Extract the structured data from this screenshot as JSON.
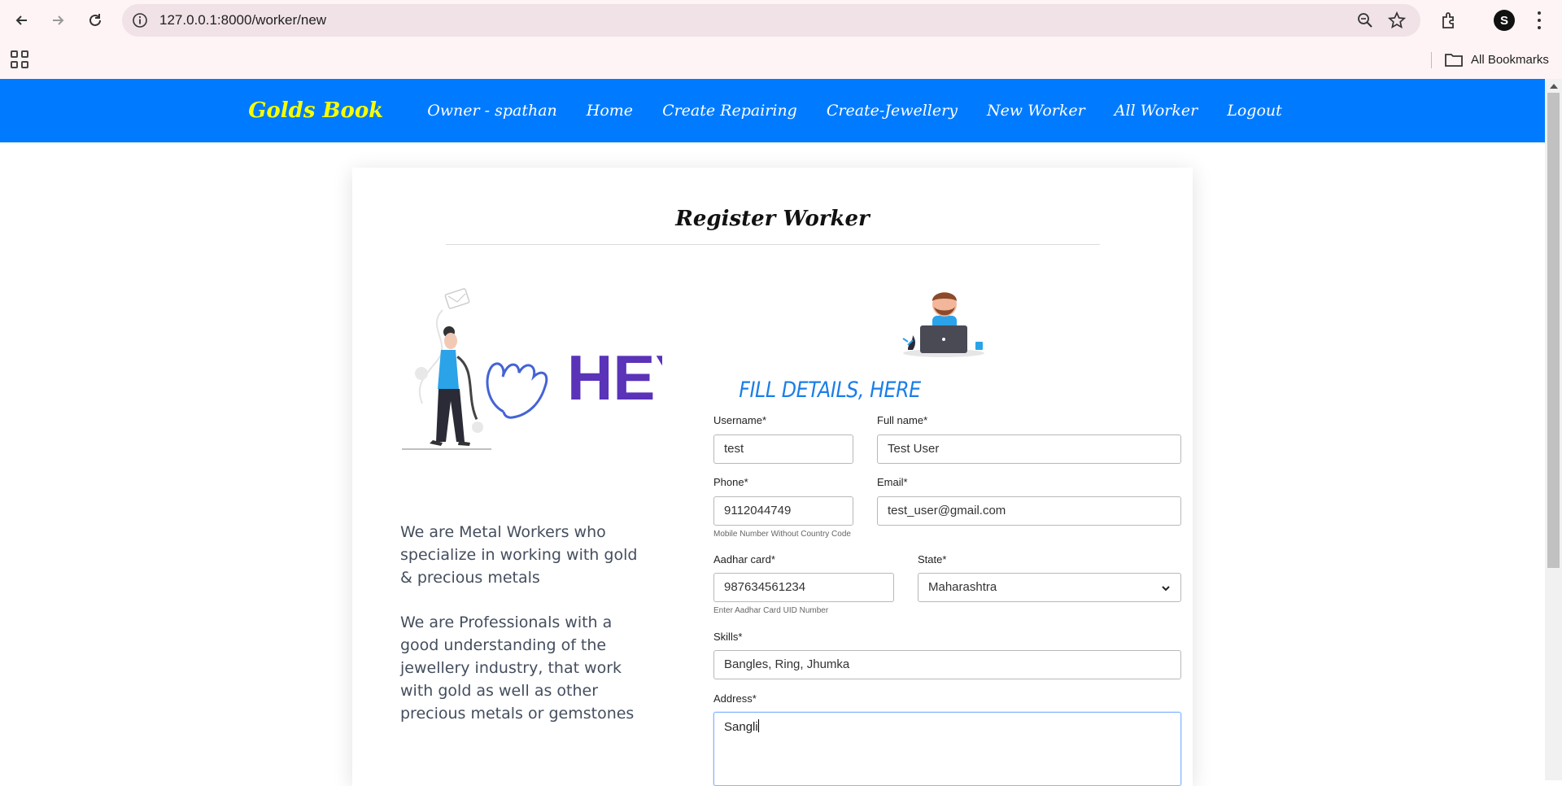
{
  "browser": {
    "url": "127.0.0.1:8000/worker/new",
    "bookmarks_label": "All Bookmarks",
    "profile_initial": "S"
  },
  "navbar": {
    "brand": "Golds Book",
    "links": [
      "Owner - spathan",
      "Home",
      "Create Repairing",
      "Create-Jewellery",
      "New Worker",
      "All Worker",
      "Logout"
    ],
    "bg_color": "#007bff",
    "brand_color": "#f6ff00"
  },
  "card": {
    "title": "Register Worker",
    "hey_text": "HEY",
    "about_paragraphs": [
      "We are Metal Workers who specialize in working with gold & precious metals",
      "We are Professionals with a good understanding of the jewellery industry, that work with gold as well as other precious metals or gemstones"
    ],
    "form_heading": "FILL DETAILS, HERE"
  },
  "form": {
    "username": {
      "label": "Username*",
      "value": "test"
    },
    "fullname": {
      "label": "Full name*",
      "value": "Test User"
    },
    "phone": {
      "label": "Phone*",
      "value": "9112044749",
      "help": "Mobile Number Without Country Code"
    },
    "email": {
      "label": "Email*",
      "value": "test_user@gmail.com"
    },
    "aadhar": {
      "label": "Aadhar card*",
      "value": "987634561234",
      "help": "Enter Aadhar Card UID Number"
    },
    "state": {
      "label": "State*",
      "value": "Maharashtra"
    },
    "skills": {
      "label": "Skills*",
      "value": "Bangles, Ring, Jhumka"
    },
    "address": {
      "label": "Address*",
      "value": "Sangli"
    }
  }
}
